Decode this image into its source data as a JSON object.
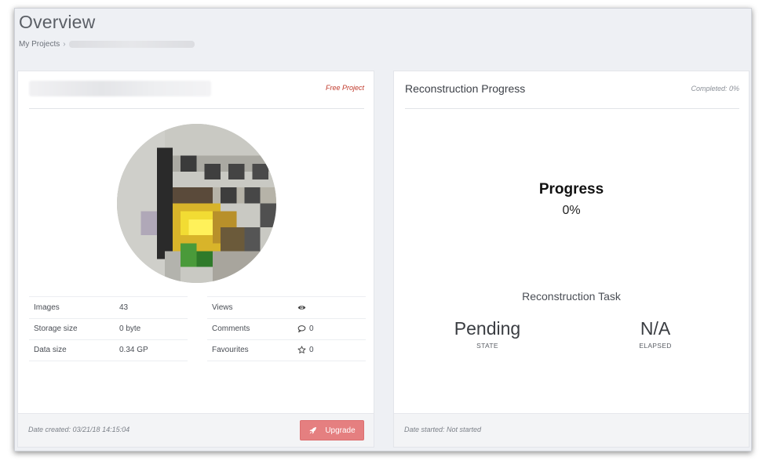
{
  "page": {
    "title": "Overview"
  },
  "breadcrumb": {
    "root": "My Projects",
    "separator": "›"
  },
  "project_card": {
    "badge": "Free Project",
    "stats_left": [
      {
        "label": "Images",
        "value": "43"
      },
      {
        "label": "Storage size",
        "value": "0 byte"
      },
      {
        "label": "Data size",
        "value": "0.34 GP"
      }
    ],
    "stats_right": [
      {
        "label": "Views",
        "value": "",
        "icon": "eye-icon"
      },
      {
        "label": "Comments",
        "value": "0",
        "icon": "comment-icon"
      },
      {
        "label": "Favourites",
        "value": "0",
        "icon": "star-icon"
      }
    ],
    "footer": {
      "date_created": "Date created: 03/21/18 14:15:04",
      "upgrade_label": "Upgrade",
      "upgrade_icon": "rocket-icon"
    },
    "colors": {
      "badge": "#c0392b",
      "upgrade_button": "#e57f80"
    }
  },
  "reconstruction_card": {
    "title": "Reconstruction Progress",
    "completed": "Completed: 0%",
    "progress_label": "Progress",
    "progress_value": "0%",
    "task_title": "Reconstruction Task",
    "state_value": "Pending",
    "state_label": "STATE",
    "elapsed_value": "N/A",
    "elapsed_label": "ELAPSED",
    "footer": {
      "date_started": "Date started: Not started"
    }
  }
}
